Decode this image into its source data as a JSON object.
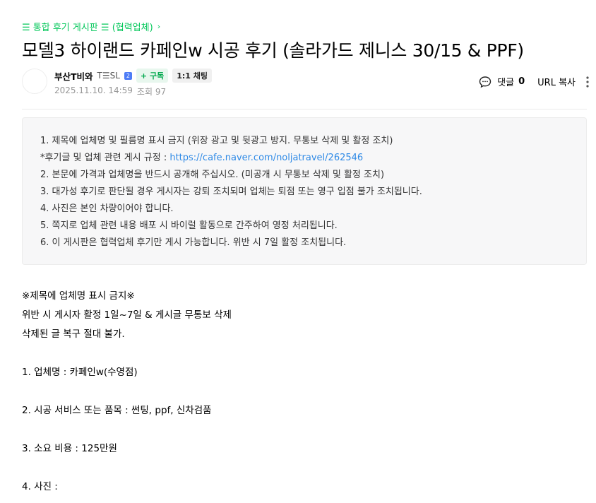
{
  "board": {
    "label": "☰ 통합 후기 게시판 ☰ (협력업체)",
    "chevron": "›"
  },
  "post": {
    "title": "모델3 하이랜드 카페인w 시공 후기 (솔라가드 제니스 30/15 & PPF)",
    "author": {
      "name": "부산T비와",
      "level": "T☰SL",
      "level_badge": "2",
      "subscribe_label": "+ 구독",
      "chat_label": "1:1 채팅"
    },
    "date": "2025.11.10. 14:59",
    "views_label": "조회 97"
  },
  "actions": {
    "comment_label": "댓글",
    "comment_count": "0",
    "url_copy_label": "URL 복사"
  },
  "notice": {
    "items": [
      "1. 제목에 업체명 및 필름명 표시 금지 (위장 광고 및 뒷광고 방지. 무통보 삭제 및 활정 조치)",
      "*후기글 및 업체 관련 게시 규정 : ",
      "2. 본문에 가격과 업체명을 반드시 공개해 주십시오. (미공개 시 무통보 삭제 및 활정 조치)",
      "3. 대가성 후기로 판단될 경우 게시자는 강퇴 조치되며 업체는 퇴점 또는 영구 입점 불가 조치됩니다.",
      "4. 사진은 본인 차량이어야 합니다.",
      "5. 쪽지로 업체 관련 내용 배포 시 바이럴 활동으로 간주하여 영정 처리됩니다.",
      "6. 이 게시판은 협력업체 후기만 게시 가능합니다. 위반 시 7일 활정 조치됩니다."
    ],
    "link": "https://cafe.naver.com/noljatravel/262546"
  },
  "content": {
    "warning_title": "※제목에 업체명 표시 금지※",
    "warning_line1": "위반 시 게시자 활정 1일~7일 & 게시글 무통보 삭제",
    "warning_line2": "삭제된 글 복구 절대 불가.",
    "q1": "1. 업체명 :  카페인w(수영점)",
    "q2": "2. 시공 서비스 또는 품목 :  썬팅, ppf, 신차검품",
    "q3": "3. 소요 비용 :  125만원",
    "q4": "4. 사진 :"
  },
  "colors": {
    "accent": "#03c75a",
    "link": "#2f8ae6",
    "notice_bg": "#f7f7f8",
    "meta": "#979797"
  }
}
